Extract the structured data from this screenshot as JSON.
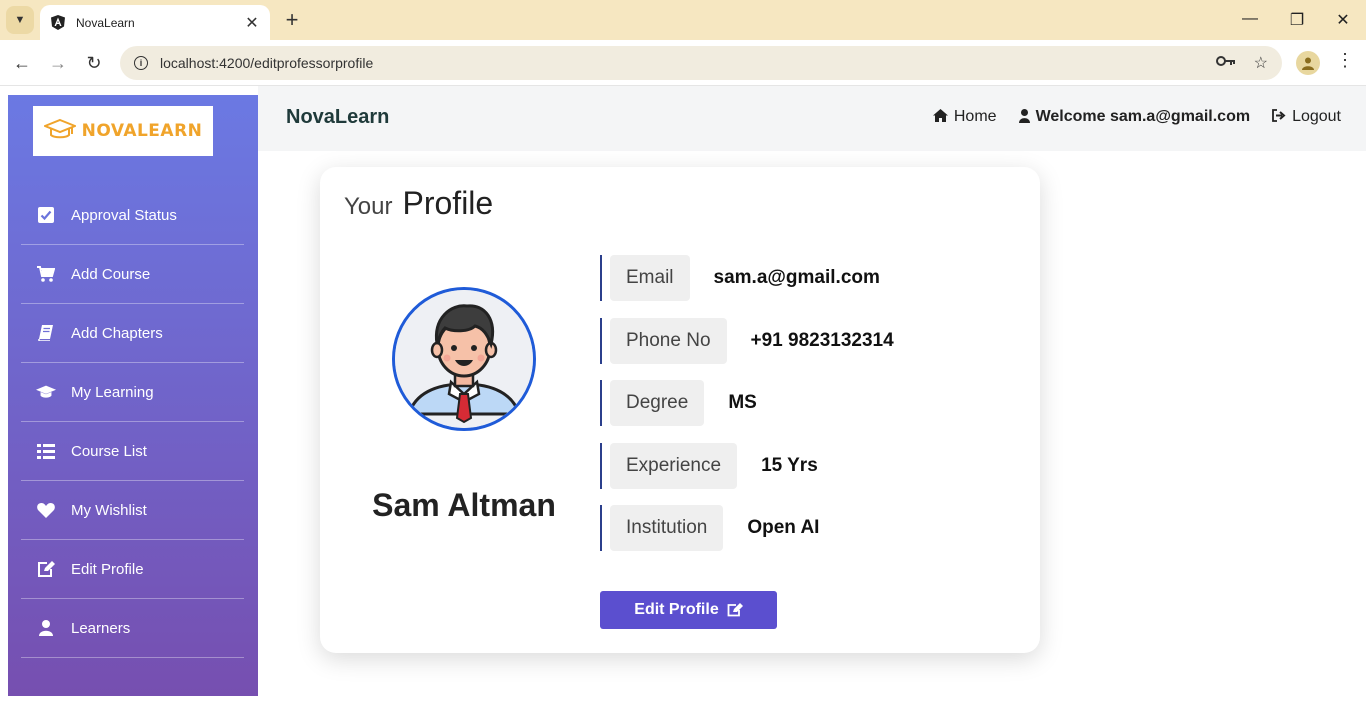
{
  "browser": {
    "tab_title": "NovaLearn",
    "url": "localhost:4200/editprofessorprofile"
  },
  "sidebar": {
    "logo_text": "NOVALEARN",
    "items": [
      {
        "label": "Approval Status",
        "icon": "check-square-icon"
      },
      {
        "label": "Add Course",
        "icon": "cart-icon"
      },
      {
        "label": "Add Chapters",
        "icon": "book-icon"
      },
      {
        "label": "My Learning",
        "icon": "graduation-cap-icon"
      },
      {
        "label": "Course List",
        "icon": "list-icon"
      },
      {
        "label": "My Wishlist",
        "icon": "heart-icon"
      },
      {
        "label": "Edit Profile",
        "icon": "edit-icon"
      },
      {
        "label": "Learners",
        "icon": "user-icon"
      }
    ]
  },
  "header": {
    "brand": "NovaLearn",
    "home_label": "Home",
    "welcome_label": "Welcome sam.a@gmail.com",
    "logout_label": "Logout"
  },
  "profile": {
    "title_prefix": "Your",
    "title": "Profile",
    "name": "Sam Altman",
    "fields": [
      {
        "label": "Email",
        "value": "sam.a@gmail.com"
      },
      {
        "label": "Phone No",
        "value": "+91 9823132314"
      },
      {
        "label": "Degree",
        "value": "MS"
      },
      {
        "label": "Experience",
        "value": "15 Yrs"
      },
      {
        "label": "Institution",
        "value": "Open AI"
      }
    ],
    "edit_button": "Edit Profile"
  },
  "colors": {
    "sidebar_top": "#6b79e3",
    "sidebar_bottom": "#764fb0",
    "accent_button": "#5b4fcf",
    "logo_orange": "#f0a42b"
  }
}
